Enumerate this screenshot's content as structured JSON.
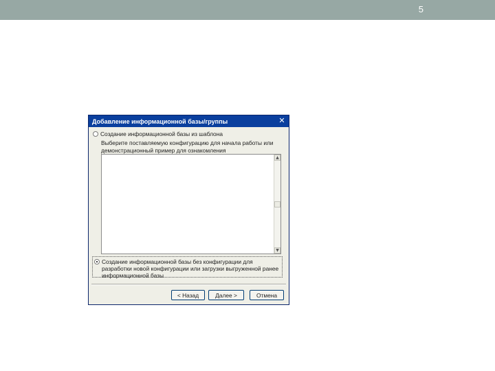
{
  "slide": {
    "number": "5"
  },
  "dialog": {
    "title": "Добавление информационной базы/группы",
    "close_glyph": "✕",
    "option_template": "Создание информационной базы из шаблона",
    "template_description": "Выберите поставляемую конфигурацию для начала работы или демонстрационный пример для ознакомления",
    "option_empty": "Создание информационной базы без конфигурации для разработки новой конфигурации или загрузки выгруженной ранее информационной базы",
    "selected_option": "option_empty",
    "buttons": {
      "back": "< Назад",
      "next": "Далее >",
      "cancel": "Отмена"
    },
    "icons": {
      "close": "close-icon",
      "scroll_up": "chevron-up-icon",
      "scroll_down": "chevron-down-icon"
    },
    "colors": {
      "titlebar": "#0a3f9e",
      "dialog_bg": "#efefe7",
      "slide_bar": "#97a8a4"
    }
  }
}
